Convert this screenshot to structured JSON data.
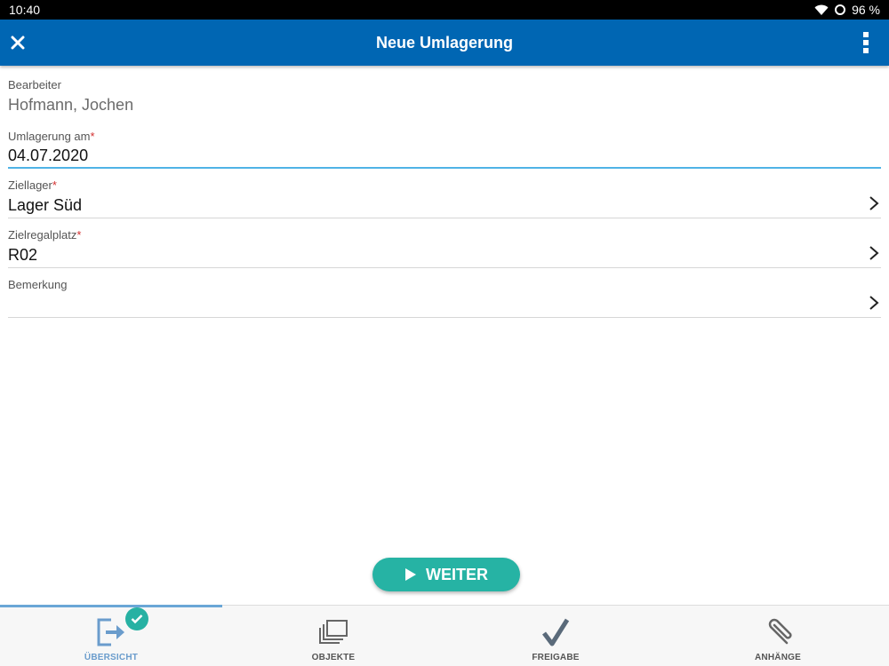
{
  "status": {
    "time": "10:40",
    "battery": "96 %"
  },
  "appbar": {
    "title": "Neue Umlagerung"
  },
  "form": {
    "bearbeiter": {
      "label": "Bearbeiter",
      "value": "Hofmann, Jochen"
    },
    "umlagerung_am": {
      "label": "Umlagerung am",
      "required": "*",
      "value": "04.07.2020"
    },
    "ziellager": {
      "label": "Ziellager",
      "required": "*",
      "value": "Lager Süd"
    },
    "zielregalplatz": {
      "label": "Zielregalplatz",
      "required": "*",
      "value": "R02"
    },
    "bemerkung": {
      "label": "Bemerkung",
      "value": ""
    }
  },
  "weiter": {
    "label": "WEITER"
  },
  "nav": {
    "tabs": [
      {
        "label": "ÜBERSICHT",
        "icon": "exit-document-icon",
        "active": true
      },
      {
        "label": "OBJEKTE",
        "icon": "stacked-objects-icon"
      },
      {
        "label": "FREIGABE",
        "icon": "checkmark-icon"
      },
      {
        "label": "ANHÄNGE",
        "icon": "paperclip-icon"
      }
    ]
  },
  "colors": {
    "appbar": "#0066b3",
    "accent": "#26b3a4",
    "focus_underline": "#4fb3e6",
    "active_tab": "#6a9ccc",
    "required": "#d32f2f"
  }
}
